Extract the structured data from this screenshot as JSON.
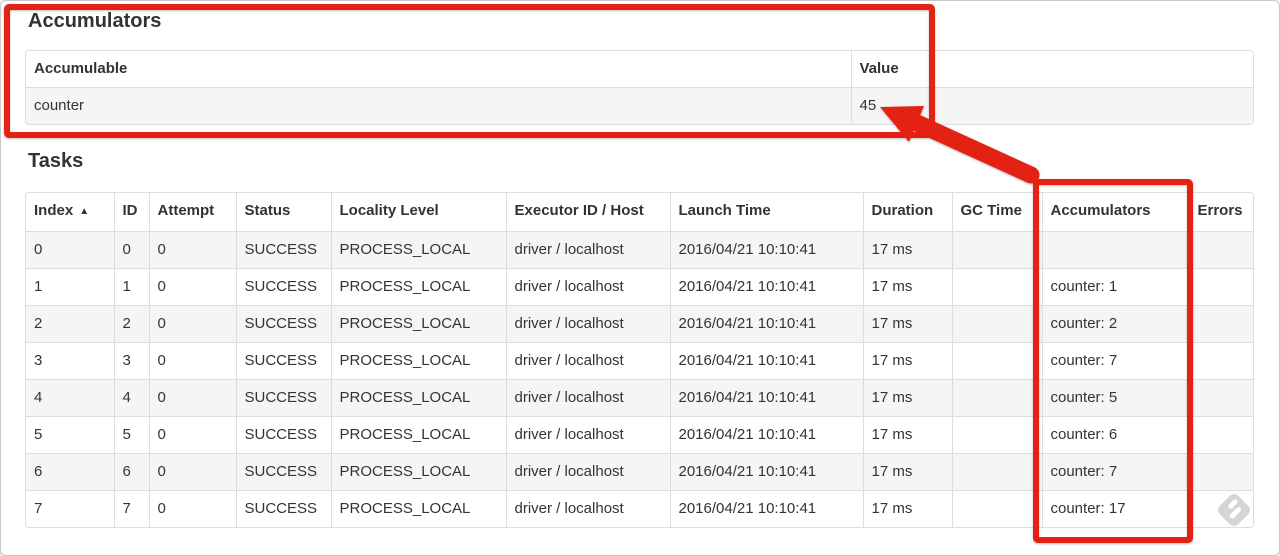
{
  "accumulators": {
    "heading": "Accumulators",
    "headers": [
      "Accumulable",
      "Value"
    ],
    "rows": [
      {
        "accumulable": "counter",
        "value": "45"
      }
    ]
  },
  "tasks": {
    "heading": "Tasks",
    "sort_icon": "▲",
    "headers": [
      "Index",
      "ID",
      "Attempt",
      "Status",
      "Locality Level",
      "Executor ID / Host",
      "Launch Time",
      "Duration",
      "GC Time",
      "Accumulators",
      "Errors"
    ],
    "column_keys": [
      "index",
      "id",
      "attempt",
      "status",
      "locality_level",
      "executor_id_host",
      "launch_time",
      "duration",
      "gc_time",
      "accumulators",
      "errors"
    ],
    "rows": [
      {
        "index": "0",
        "id": "0",
        "attempt": "0",
        "status": "SUCCESS",
        "locality_level": "PROCESS_LOCAL",
        "executor_id_host": "driver / localhost",
        "launch_time": "2016/04/21 10:10:41",
        "duration": "17 ms",
        "gc_time": "",
        "accumulators": "",
        "errors": ""
      },
      {
        "index": "1",
        "id": "1",
        "attempt": "0",
        "status": "SUCCESS",
        "locality_level": "PROCESS_LOCAL",
        "executor_id_host": "driver / localhost",
        "launch_time": "2016/04/21 10:10:41",
        "duration": "17 ms",
        "gc_time": "",
        "accumulators": "counter: 1",
        "errors": ""
      },
      {
        "index": "2",
        "id": "2",
        "attempt": "0",
        "status": "SUCCESS",
        "locality_level": "PROCESS_LOCAL",
        "executor_id_host": "driver / localhost",
        "launch_time": "2016/04/21 10:10:41",
        "duration": "17 ms",
        "gc_time": "",
        "accumulators": "counter: 2",
        "errors": ""
      },
      {
        "index": "3",
        "id": "3",
        "attempt": "0",
        "status": "SUCCESS",
        "locality_level": "PROCESS_LOCAL",
        "executor_id_host": "driver / localhost",
        "launch_time": "2016/04/21 10:10:41",
        "duration": "17 ms",
        "gc_time": "",
        "accumulators": "counter: 7",
        "errors": ""
      },
      {
        "index": "4",
        "id": "4",
        "attempt": "0",
        "status": "SUCCESS",
        "locality_level": "PROCESS_LOCAL",
        "executor_id_host": "driver / localhost",
        "launch_time": "2016/04/21 10:10:41",
        "duration": "17 ms",
        "gc_time": "",
        "accumulators": "counter: 5",
        "errors": ""
      },
      {
        "index": "5",
        "id": "5",
        "attempt": "0",
        "status": "SUCCESS",
        "locality_level": "PROCESS_LOCAL",
        "executor_id_host": "driver / localhost",
        "launch_time": "2016/04/21 10:10:41",
        "duration": "17 ms",
        "gc_time": "",
        "accumulators": "counter: 6",
        "errors": ""
      },
      {
        "index": "6",
        "id": "6",
        "attempt": "0",
        "status": "SUCCESS",
        "locality_level": "PROCESS_LOCAL",
        "executor_id_host": "driver / localhost",
        "launch_time": "2016/04/21 10:10:41",
        "duration": "17 ms",
        "gc_time": "",
        "accumulators": "counter: 7",
        "errors": ""
      },
      {
        "index": "7",
        "id": "7",
        "attempt": "0",
        "status": "SUCCESS",
        "locality_level": "PROCESS_LOCAL",
        "executor_id_host": "driver / localhost",
        "launch_time": "2016/04/21 10:10:41",
        "duration": "17 ms",
        "gc_time": "",
        "accumulators": "counter: 17",
        "errors": ""
      }
    ]
  },
  "annotations": {
    "color": "#e32213"
  },
  "watermark": {
    "color": "#d5d5d5"
  }
}
